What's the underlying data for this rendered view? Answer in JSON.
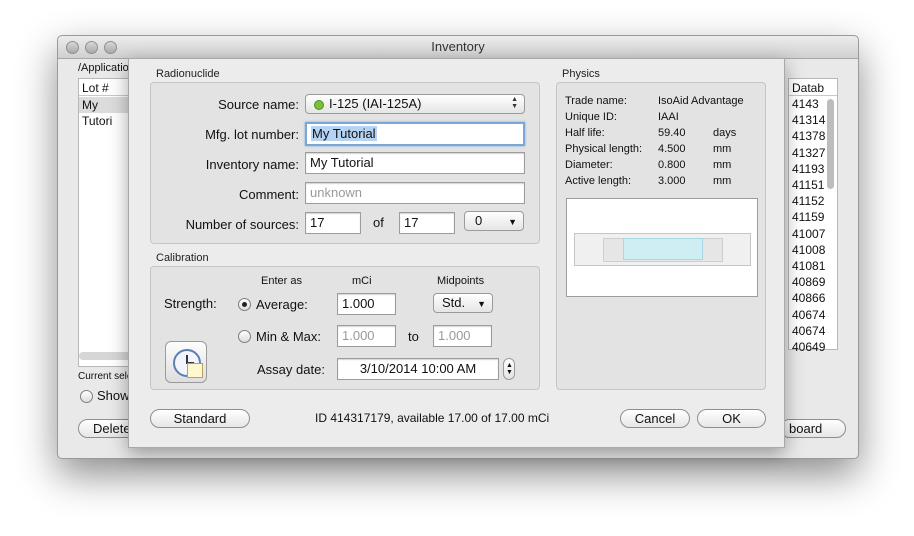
{
  "window": {
    "title": "Inventory"
  },
  "background": {
    "path_label": "/Applicatio",
    "table_header_left": "Lot #",
    "table_first_cell": "My Tutori",
    "table_header_right": "Datab",
    "right_column_values": [
      "4143",
      "41314",
      "41378",
      "41327",
      "41193",
      "41151",
      "41152",
      "41159",
      "41007",
      "41008",
      "41081",
      "40869",
      "40866",
      "40674",
      "40674",
      "40649"
    ],
    "current_selection_label": "Current sele",
    "show_all_label": "Show",
    "delete_button": "Delete",
    "clipboard_button": "board"
  },
  "radionuclide": {
    "group_label": "Radionuclide",
    "source_name_label": "Source name:",
    "source_name_value": "I-125 (IAI-125A)",
    "mfg_lot_label": "Mfg. lot number:",
    "mfg_lot_value": "My Tutorial",
    "inventory_name_label": "Inventory name:",
    "inventory_name_value": "My Tutorial",
    "comment_label": "Comment:",
    "comment_placeholder": "unknown",
    "num_sources_label": "Number of sources:",
    "num_sources_value": "17",
    "of_label": "of",
    "num_sources_total": "17",
    "num_sources_extra": "0"
  },
  "physics": {
    "group_label": "Physics",
    "rows": [
      {
        "label": "Trade name:",
        "value": "IsoAid Advantage",
        "unit": ""
      },
      {
        "label": "Unique ID:",
        "value": "IAAI",
        "unit": ""
      },
      {
        "label": "Half life:",
        "value": "59.40",
        "unit": "days"
      },
      {
        "label": "Physical length:",
        "value": "4.500",
        "unit": "mm"
      },
      {
        "label": "Diameter:",
        "value": "0.800",
        "unit": "mm"
      },
      {
        "label": "Active length:",
        "value": "3.000",
        "unit": "mm"
      }
    ]
  },
  "calibration": {
    "group_label": "Calibration",
    "enter_as_label": "Enter as",
    "unit_label": "mCi",
    "midpoints_label": "Midpoints",
    "strength_label": "Strength:",
    "average_label": "Average:",
    "average_value": "1.000",
    "midpoints_value": "Std.",
    "minmax_label": "Min & Max:",
    "min_placeholder": "1.000",
    "to_label": "to",
    "max_placeholder": "1.000",
    "assay_label": "Assay date:",
    "assay_value": "3/10/2014 10:00 AM",
    "selected_mode": "average"
  },
  "footer": {
    "standard_button": "Standard",
    "status": "ID 414317179, available 17.00 of 17.00 mCi",
    "cancel_button": "Cancel",
    "ok_button": "OK"
  },
  "colors": {
    "focus_ring": "#7aa7d6",
    "source_active": "#cfeef4",
    "status_dot": "#7bbf3a"
  }
}
